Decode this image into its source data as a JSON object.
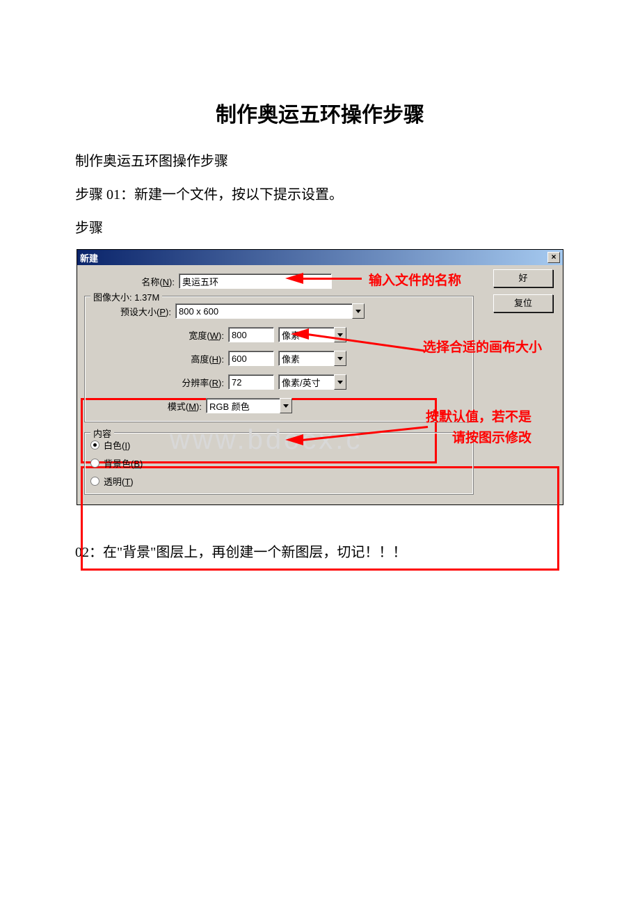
{
  "doc": {
    "title": "制作奥运五环操作步骤",
    "para1": "制作奥运五环图操作步骤",
    "para2": "步骤 01：新建一个文件，按以下提示设置。",
    "para3": "步骤",
    "para4": "02：在\"背景\"图层上，再创建一个新图层，切记！！！"
  },
  "dialog": {
    "title": "新建",
    "close": "×",
    "name_label": "名称(N):",
    "name_value": "奥运五环",
    "ok_btn": "好",
    "reset_btn": "复位",
    "size_legend": "图像大小: 1.37M",
    "preset_label": "预设大小(P):",
    "preset_value": "800 x 600",
    "width_label": "宽度(W):",
    "width_value": "800",
    "width_unit": "像素",
    "height_label": "高度(H):",
    "height_value": "600",
    "height_unit": "像素",
    "res_label": "分辨率(R):",
    "res_value": "72",
    "res_unit": "像素/英寸",
    "mode_label": "模式(M):",
    "mode_value": "RGB 颜色",
    "content_legend": "内容",
    "radio1": "白色(I)",
    "radio2": "背景色(B)",
    "radio3": "透明(T)"
  },
  "anno": {
    "a1": "输入文件的名称",
    "a2": "选择合适的画布大小",
    "a3_line1": "按默认值，若不是",
    "a3_line2": "请按图示修改"
  },
  "watermark": "www.bdocx.c"
}
